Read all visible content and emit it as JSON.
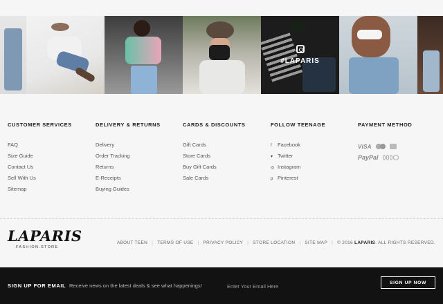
{
  "instagram": {
    "hashtag": "#LAPARIS",
    "tiles": [
      {
        "name": "instagram-photo-1"
      },
      {
        "name": "instagram-photo-2"
      },
      {
        "name": "instagram-photo-3"
      },
      {
        "name": "instagram-photo-4"
      },
      {
        "name": "instagram-photo-5"
      },
      {
        "name": "instagram-photo-6"
      },
      {
        "name": "instagram-photo-7"
      }
    ]
  },
  "columns": {
    "customer": {
      "title": "CUSTOMER SERVICES",
      "items": [
        "FAQ",
        "Size Guide",
        "Contact Us",
        "Sell With Us",
        "Sitemap"
      ]
    },
    "delivery": {
      "title": "DELIVERY & RETURNS",
      "items": [
        "Delivery",
        "Order Tracking",
        "Returns",
        "E-Receipts",
        "Buying Guides"
      ]
    },
    "cards": {
      "title": "CARDS & DISCOUNTS",
      "items": [
        "Gift Cards",
        "Store Cards",
        "Buy Gift Cards",
        "Sale Cards"
      ]
    },
    "follow": {
      "title": "FOLLOW TEENAGE",
      "items": [
        {
          "icon": "facebook-icon",
          "glyph": "f",
          "label": "Facebook"
        },
        {
          "icon": "twitter-icon",
          "glyph": "▾",
          "label": "Twitter"
        },
        {
          "icon": "instagram-icon",
          "glyph": "◎",
          "label": "Instagram"
        },
        {
          "icon": "pinterest-icon",
          "glyph": "p",
          "label": "Pinterest"
        }
      ]
    },
    "payment": {
      "title": "PAYMENT METHOD",
      "visa": "VISA",
      "paypal": "PayPal"
    }
  },
  "brand": {
    "logo": "LAPARIS",
    "tagline": "FASHION.STORE"
  },
  "bottom_links": [
    "ABOUT TEEN",
    "TERMS OF USE",
    "PRIVACY POLICY",
    "STORE LOCATION",
    "SITE MAP"
  ],
  "copyright": {
    "prefix": "© 2016",
    "brand": "LAPARIS",
    "suffix": ". ALL RIGHTS RESERVED."
  },
  "newsletter": {
    "title": "SIGN UP FOR EMAIL",
    "description": "Receive news on the latest deals & see what happenings!",
    "placeholder": "Enter Your Email Here",
    "button": "SIGN UP NOW"
  },
  "colors": {
    "background": "#f6f6f6",
    "newsletter_bg": "#121212",
    "text": "#333333"
  }
}
